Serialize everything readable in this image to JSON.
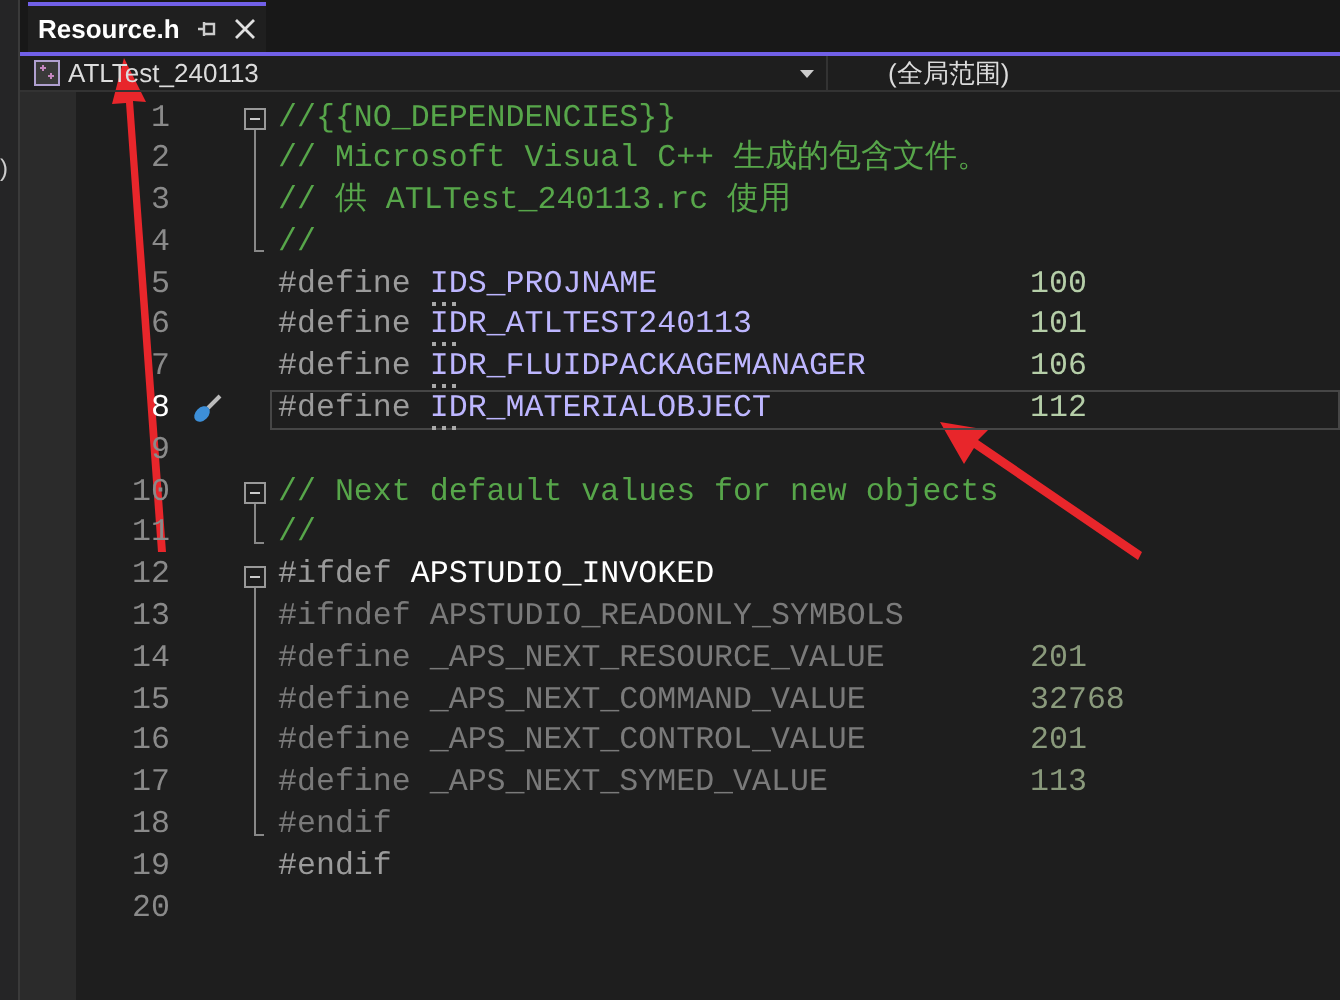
{
  "side_panel": {
    "fragment": ")"
  },
  "tab": {
    "title": "Resource.h",
    "selected": true
  },
  "nav": {
    "project": "ATLTest_240113",
    "scope": "(全局范围)"
  },
  "lines": [
    {
      "number": "1",
      "current": false,
      "expanded": true,
      "tokens": [
        {
          "kind": "comment",
          "text": "//{{NO_DEPENDENCIES}}"
        }
      ],
      "children": [
        {
          "number": "2",
          "current": false,
          "tokens": [
            {
              "kind": "comment",
              "text": "// Microsoft Visual C++ 生成的包含文件。"
            }
          ]
        },
        {
          "number": "3",
          "current": false,
          "tokens": [
            {
              "kind": "comment",
              "text": "// 供 ATLTest_240113.rc 使用"
            }
          ]
        },
        {
          "number": "4",
          "current": false,
          "tokens": [
            {
              "kind": "comment",
              "text": "//"
            }
          ]
        }
      ]
    },
    {
      "number": "5",
      "current": false,
      "tokens": [
        {
          "kind": "directive",
          "text": "#define"
        },
        {
          "kind": "macro",
          "text": "IDS_PROJNAME",
          "hint": true
        }
      ],
      "value": {
        "kind": "number",
        "text": "100"
      }
    },
    {
      "number": "6",
      "current": false,
      "tokens": [
        {
          "kind": "directive",
          "text": "#define"
        },
        {
          "kind": "macro",
          "text": "IDR_ATLTEST240113",
          "hint": true
        }
      ],
      "value": {
        "kind": "number",
        "text": "101"
      }
    },
    {
      "number": "7",
      "current": false,
      "tokens": [
        {
          "kind": "directive",
          "text": "#define"
        },
        {
          "kind": "macro",
          "text": "IDR_FLUIDPACKAGEMANAGER",
          "hint": true
        }
      ],
      "value": {
        "kind": "number",
        "text": "106"
      }
    },
    {
      "number": "8",
      "current": true,
      "tokens": [
        {
          "kind": "directive",
          "text": "#define"
        },
        {
          "kind": "macro",
          "text": "IDR_MATERIALOBJECT",
          "hint": true
        }
      ],
      "value": {
        "kind": "number",
        "text": "112"
      }
    },
    {
      "number": "9",
      "current": false
    },
    {
      "number": "10",
      "current": false,
      "expanded": true,
      "tokens": [
        {
          "kind": "comment",
          "text": "// Next default values for new objects"
        }
      ],
      "children": [
        {
          "number": "11",
          "current": false,
          "tokens": [
            {
              "kind": "comment",
              "text": "//"
            }
          ]
        }
      ]
    },
    {
      "number": "12",
      "current": false,
      "expanded": true,
      "tokens": [
        {
          "kind": "directive",
          "text": "#ifdef"
        },
        {
          "kind": "plain",
          "text": "APSTUDIO_INVOKED"
        }
      ],
      "children": [
        {
          "number": "13",
          "current": false,
          "tokens": [
            {
              "kind": "inactive",
              "text": "#ifndef"
            },
            {
              "kind": "inactive",
              "text": "APSTUDIO_READONLY_SYMBOLS"
            }
          ]
        },
        {
          "number": "14",
          "current": false,
          "tokens": [
            {
              "kind": "inactive",
              "text": "#define"
            },
            {
              "kind": "inactive",
              "text": "_APS_NEXT_RESOURCE_VALUE"
            }
          ],
          "value": {
            "kind": "inactive_number",
            "text": "201"
          }
        },
        {
          "number": "15",
          "current": false,
          "tokens": [
            {
              "kind": "inactive",
              "text": "#define"
            },
            {
              "kind": "inactive",
              "text": "_APS_NEXT_COMMAND_VALUE"
            }
          ],
          "value": {
            "kind": "inactive_number",
            "text": "32768"
          }
        },
        {
          "number": "16",
          "current": false,
          "tokens": [
            {
              "kind": "inactive",
              "text": "#define"
            },
            {
              "kind": "inactive",
              "text": "_APS_NEXT_CONTROL_VALUE"
            }
          ],
          "value": {
            "kind": "inactive_number",
            "text": "201"
          }
        },
        {
          "number": "17",
          "current": false,
          "tokens": [
            {
              "kind": "inactive",
              "text": "#define"
            },
            {
              "kind": "inactive",
              "text": "_APS_NEXT_SYMED_VALUE"
            }
          ],
          "value": {
            "kind": "inactive_number",
            "text": "113"
          }
        },
        {
          "number": "18",
          "current": false,
          "tokens": [
            {
              "kind": "inactive",
              "text": "#endif"
            }
          ]
        }
      ]
    },
    {
      "number": "19",
      "current": false,
      "tokens": [
        {
          "kind": "directive",
          "text": "#endif"
        }
      ]
    },
    {
      "number": "20",
      "current": false
    }
  ]
}
